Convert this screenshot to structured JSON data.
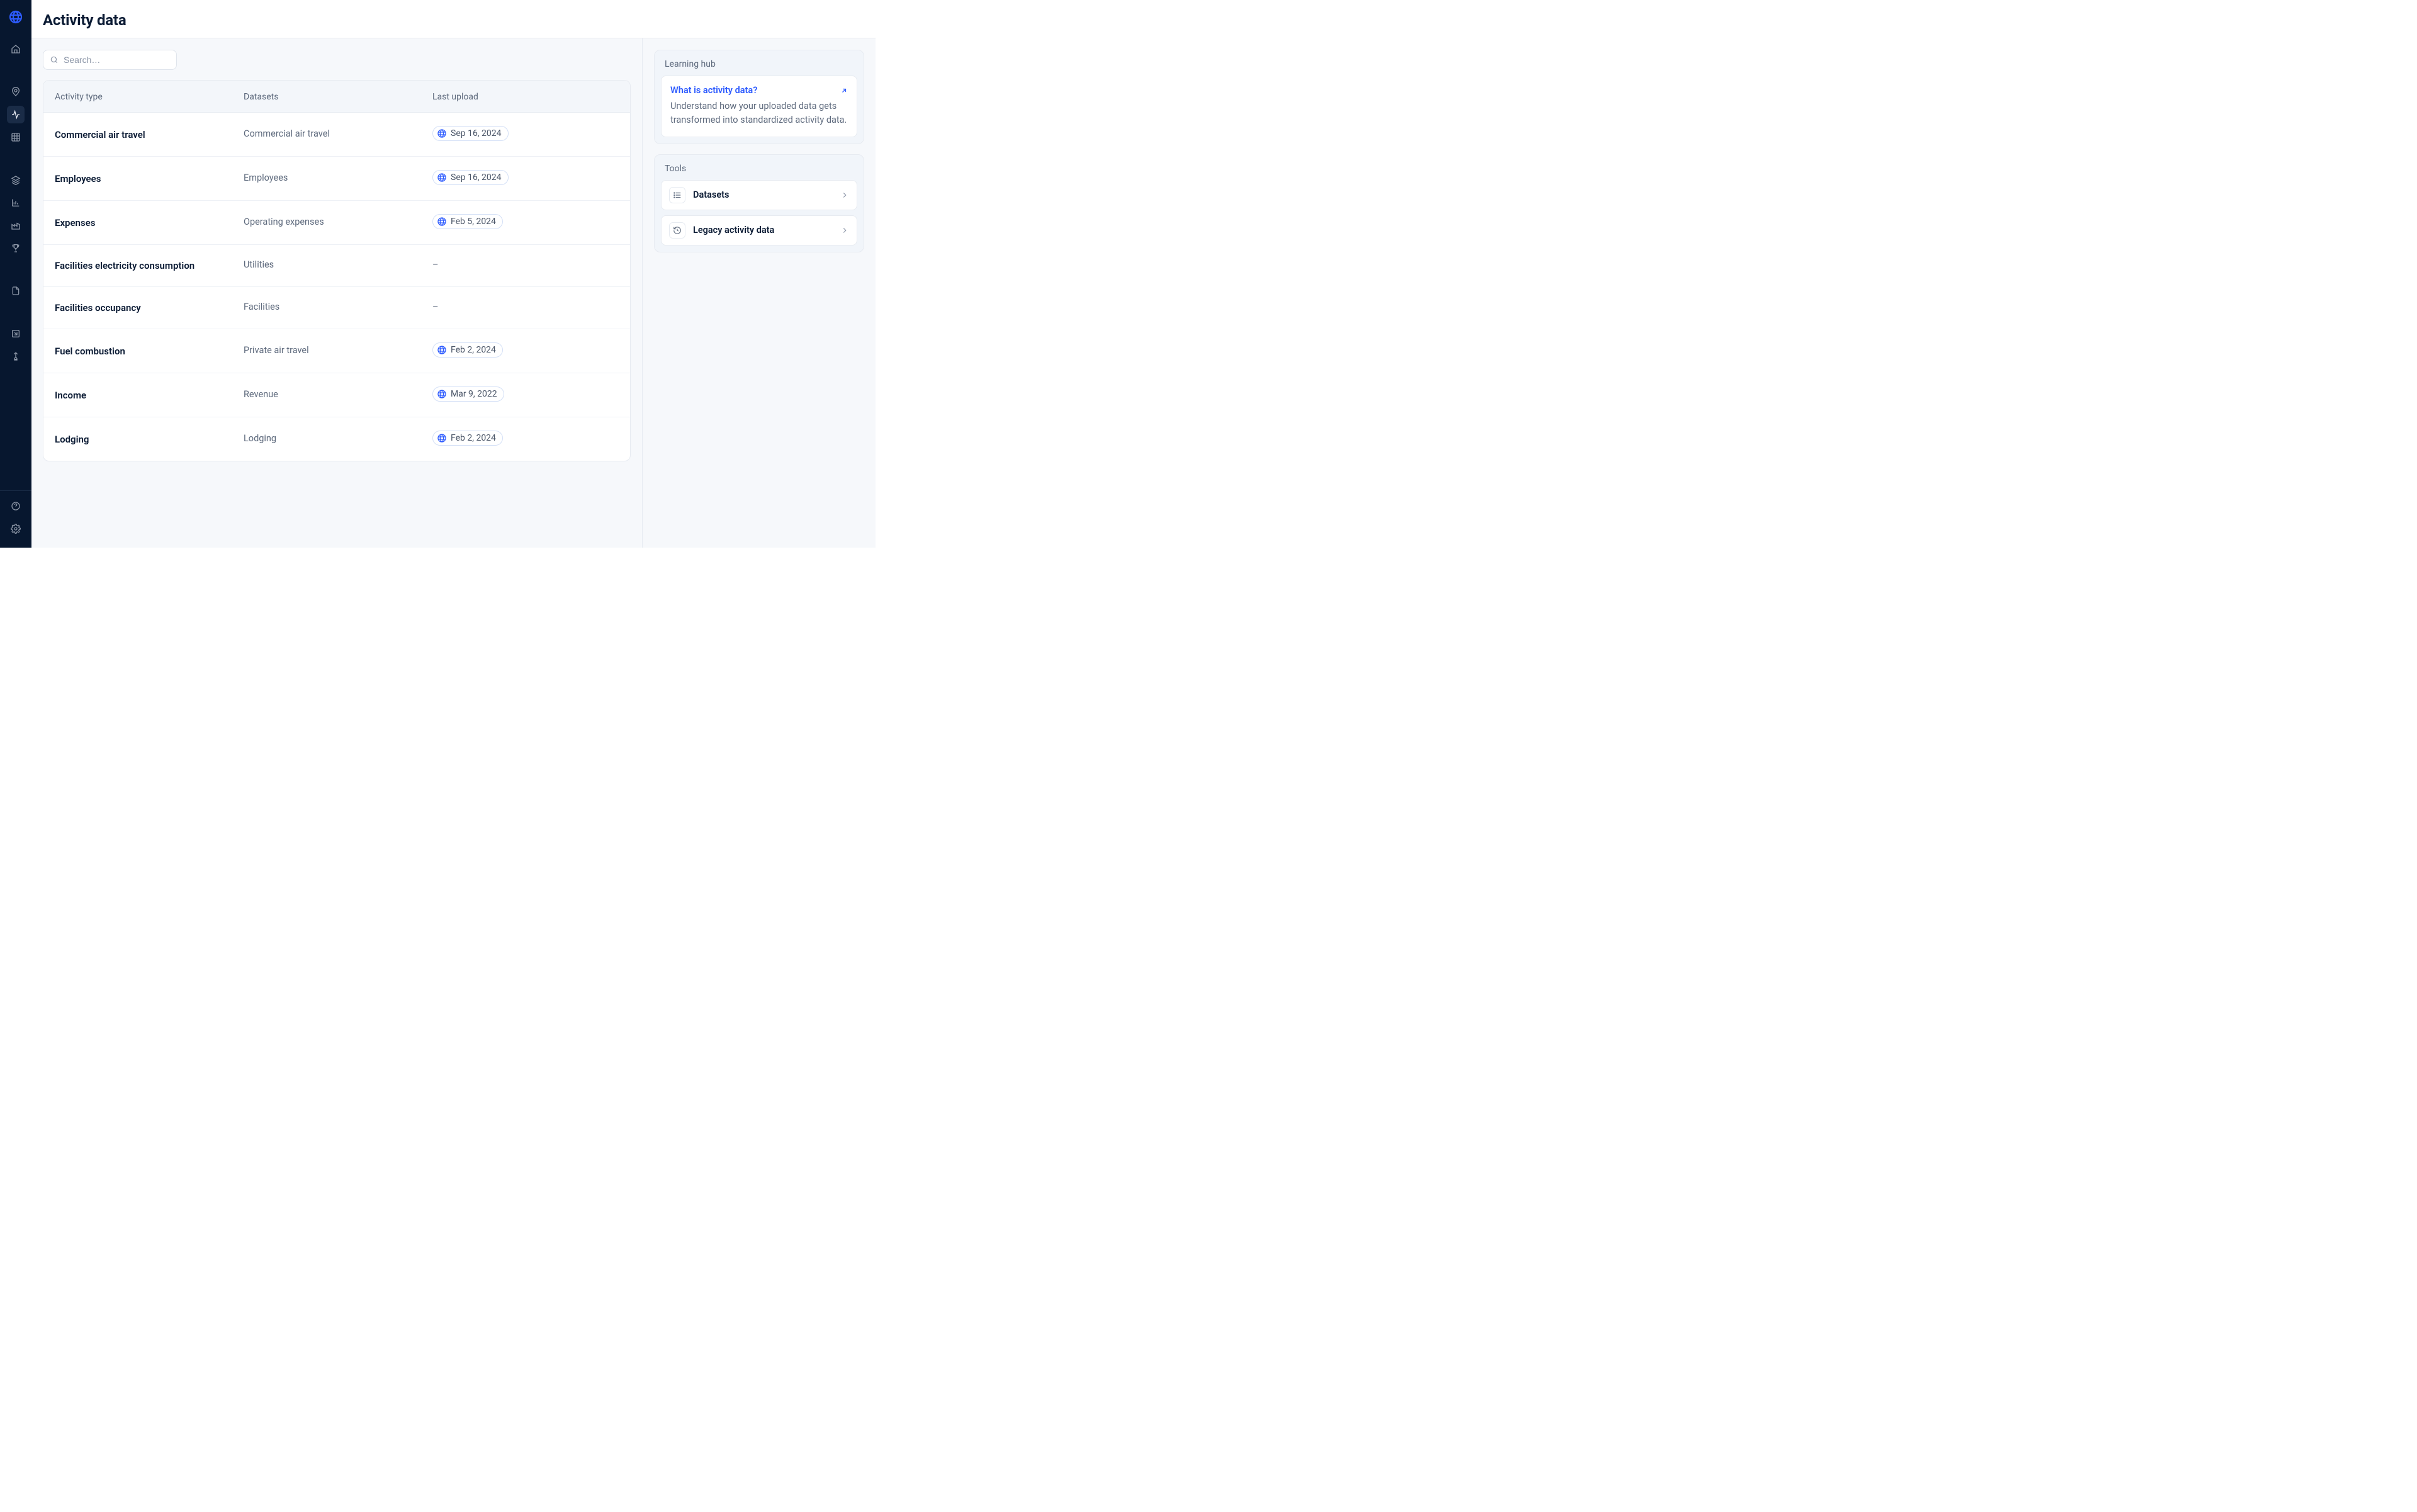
{
  "header": {
    "title": "Activity data"
  },
  "search": {
    "placeholder": "Search…"
  },
  "columns": {
    "c0": "Activity type",
    "c1": "Datasets",
    "c2": "Last upload"
  },
  "rows": [
    {
      "activity": "Commercial air travel",
      "dataset": "Commercial air travel",
      "upload": "Sep 16, 2024"
    },
    {
      "activity": "Employees",
      "dataset": "Employees",
      "upload": "Sep 16, 2024"
    },
    {
      "activity": "Expenses",
      "dataset": "Operating expenses",
      "upload": "Feb 5, 2024"
    },
    {
      "activity": "Facilities electricity consumption",
      "dataset": "Utilities",
      "upload": ""
    },
    {
      "activity": "Facilities occupancy",
      "dataset": "Facilities",
      "upload": ""
    },
    {
      "activity": "Fuel combustion",
      "dataset": "Private air travel",
      "upload": "Feb 2, 2024"
    },
    {
      "activity": "Income",
      "dataset": "Revenue",
      "upload": "Mar 9, 2022"
    },
    {
      "activity": "Lodging",
      "dataset": "Lodging",
      "upload": "Feb 2, 2024"
    }
  ],
  "empty_upload": "–",
  "learning": {
    "title": "Learning hub",
    "link": "What is activity data?",
    "body": "Understand how your uploaded data gets transformed into standardized activity data."
  },
  "tools": {
    "title": "Tools",
    "items": [
      {
        "icon": "list",
        "label": "Datasets"
      },
      {
        "icon": "history",
        "label": "Legacy activity data"
      }
    ]
  }
}
